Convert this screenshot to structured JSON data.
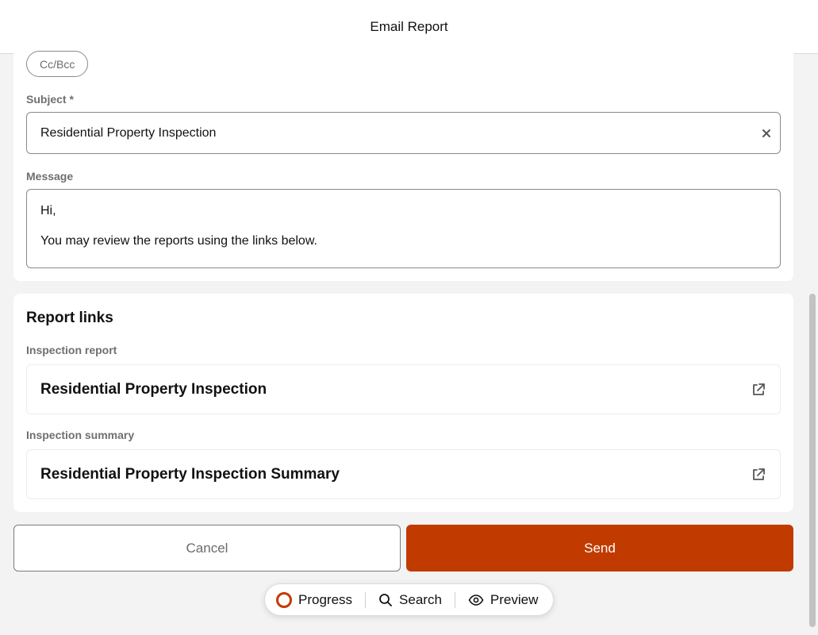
{
  "header": {
    "title": "Email Report"
  },
  "email": {
    "ccbcc_label": "Cc/Bcc",
    "subject": {
      "label": "Subject *",
      "value": "Residential Property Inspection"
    },
    "message": {
      "label": "Message",
      "lines": [
        "Hi,",
        "You may review the reports using the links below."
      ]
    }
  },
  "report_links": {
    "title": "Report links",
    "items": [
      {
        "label": "Inspection report",
        "link_text": "Residential Property Inspection"
      },
      {
        "label": "Inspection summary",
        "link_text": "Residential Property Inspection Summary"
      }
    ]
  },
  "actions": {
    "cancel_label": "Cancel",
    "send_label": "Send"
  },
  "toolbar": {
    "items": [
      {
        "label": "Progress",
        "icon": "progress-ring-icon"
      },
      {
        "label": "Search",
        "icon": "search-icon"
      },
      {
        "label": "Preview",
        "icon": "eye-icon"
      }
    ]
  },
  "colors": {
    "accent": "#c13b00",
    "border": "#8a8a8a",
    "background": "#f3f3f3"
  }
}
